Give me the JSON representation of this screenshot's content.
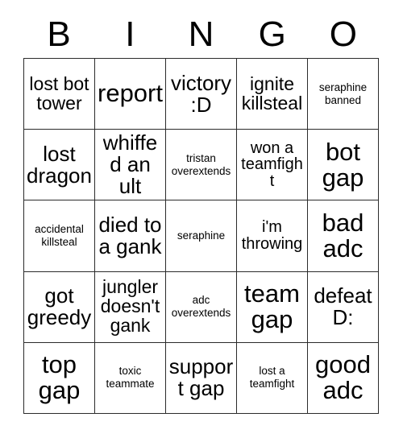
{
  "card": {
    "type": "bingo-card",
    "columns": 5,
    "rows": 5,
    "background_color": "#ffffff",
    "text_color": "#000000",
    "grid_line_color": "#2b2b2b",
    "header": {
      "letters": [
        "B",
        "I",
        "N",
        "G",
        "O"
      ]
    },
    "cells": [
      {
        "text": "lost bot tower",
        "size": "md"
      },
      {
        "text": "report",
        "size": "xl"
      },
      {
        "text": "victory :D",
        "size": "lg"
      },
      {
        "text": "ignite killsteal",
        "size": "md"
      },
      {
        "text": "seraphine banned",
        "size": "xs"
      },
      {
        "text": "lost dragon",
        "size": "lg"
      },
      {
        "text": "whiffed an ult",
        "size": "lg"
      },
      {
        "text": "tristan overextends",
        "size": "xs"
      },
      {
        "text": "won a teamfight",
        "size": "sm"
      },
      {
        "text": "bot gap",
        "size": "xl"
      },
      {
        "text": "accidental killsteal",
        "size": "xs"
      },
      {
        "text": "died to a gank",
        "size": "lg"
      },
      {
        "text": "seraphine",
        "size": "xs"
      },
      {
        "text": "i'm throwing",
        "size": "sm"
      },
      {
        "text": "bad adc",
        "size": "xl"
      },
      {
        "text": "got greedy",
        "size": "lg"
      },
      {
        "text": "jungler doesn't gank",
        "size": "md"
      },
      {
        "text": "adc overextends",
        "size": "xs"
      },
      {
        "text": "team gap",
        "size": "xl"
      },
      {
        "text": "defeat D:",
        "size": "lg"
      },
      {
        "text": "top gap",
        "size": "xl"
      },
      {
        "text": "toxic teammate",
        "size": "xs"
      },
      {
        "text": "support gap",
        "size": "lg"
      },
      {
        "text": "lost a teamfight",
        "size": "xs"
      },
      {
        "text": "good adc",
        "size": "xl"
      }
    ]
  }
}
